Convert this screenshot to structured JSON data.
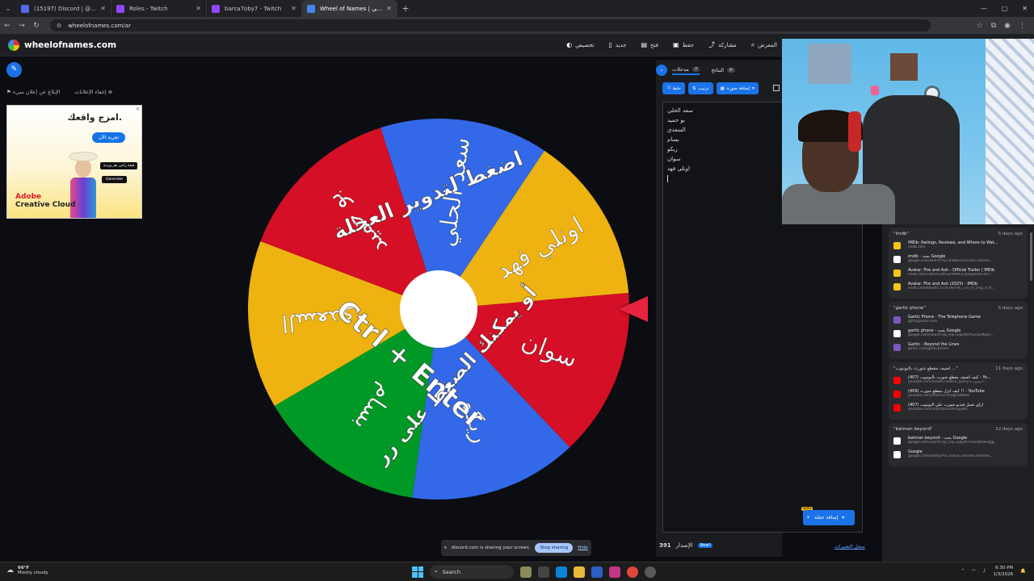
{
  "browser": {
    "tabs": [
      {
        "title": "(15197) Discord | @imvo",
        "color": "#5865f2",
        "active": false
      },
      {
        "title": "Roles - Twitch",
        "color": "#9146ff",
        "active": false
      },
      {
        "title": "barca7oby7 - Twitch",
        "color": "#9146ff",
        "active": false
      },
      {
        "title": "Wheel of Names | عجلة العشوائي",
        "color": "#4885ed",
        "active": true
      }
    ],
    "new_tab": "+",
    "url": "wheelofnames.com/ar"
  },
  "site": {
    "logo": "wheelofnames.com",
    "menu": [
      {
        "label": "المعرض",
        "icon": "⌕"
      },
      {
        "label": "مشاركة",
        "icon": "⤴"
      },
      {
        "label": "حفظ",
        "icon": "▣"
      },
      {
        "label": "فتح",
        "icon": "▤"
      },
      {
        "label": "جديد",
        "icon": "▯"
      },
      {
        "label": "تخصيص",
        "icon": "◐"
      }
    ]
  },
  "ad": {
    "hide_ads": "إخفاء الإعلانات",
    "report_ad": "الإبلاغ عن إعلان سيء",
    "headline": "امزج واقعك.",
    "cta": "تجربة الآن",
    "chip1": "قبعة راعي بقر وردية",
    "chip2": "Generate",
    "brand_line1": "Adobe",
    "brand_line2": "Creative Cloud"
  },
  "wheel": {
    "segments": [
      {
        "text": "سعد الحلي",
        "color": "#3369e8"
      },
      {
        "text": "اونلي فهد",
        "color": "#eeb211"
      },
      {
        "text": "سوان",
        "color": "#d50f25"
      },
      {
        "text": "ريكو",
        "color": "#3369e8"
      },
      {
        "text": "بسام",
        "color": "#009925"
      },
      {
        "text": "السعدي",
        "color": "#eeb211"
      },
      {
        "text": "بو حميد",
        "color": "#d50f25"
      }
    ],
    "overlay_line1": "اضغط لتدوير العجلة",
    "overlay_line2": "أو يمكنك الضغط على زر",
    "overlay_line3": "Ctrl + Enter"
  },
  "panel": {
    "tabs": [
      {
        "label": "مدخلات",
        "count": "7"
      },
      {
        "label": "النتائج",
        "count": "0"
      }
    ],
    "tools": [
      {
        "label": "خلط",
        "icon": "⤨"
      },
      {
        "label": "ترتيب",
        "icon": "⇅"
      },
      {
        "label": "إضافة صورة",
        "icon": "▦"
      }
    ],
    "entries": [
      "سعد الحلي",
      "بو حميد",
      "السعدي",
      "بسام",
      "ريكو",
      "سوان",
      "اونلي فهد"
    ],
    "add_image": "إضافة عجلة",
    "beta": "Beta",
    "version_label": "الإصدار",
    "version_number": "391",
    "new_badge": "New!",
    "changelog": "سجل التغييرات"
  },
  "history": [
    {
      "query": "\"imdb\"",
      "age": "5 days ago",
      "items": [
        {
          "title": "IMDb: Ratings, Reviews, and Where to Wat...",
          "url": "imdb.com",
          "color": "#f5c518"
        },
        {
          "title": "imdb - بحث Google",
          "url": "google.com/search?q=imdb&sourceid=chrome...",
          "color": "#ffffff"
        },
        {
          "title": "Avatar: Fire and Ash - Official Trailer | IMDb",
          "url": "imdb.com/video/vi2953299993/?playlistId=tt17...",
          "color": "#f5c518"
        },
        {
          "title": "Avatar: Fire and Ash (2025) - IMDb",
          "url": "imdb.com/title/tt1757678/?ref_=nv_sr_srsg_4_tt...",
          "color": "#f5c518"
        }
      ]
    },
    {
      "query": "\"gartic phone\"",
      "age": "5 days ago",
      "items": [
        {
          "title": "Gartic Phone - The Telephone Game",
          "url": "garticphone.com",
          "color": "#7e57c2"
        },
        {
          "title": "gartic phone - بحث Google",
          "url": "google.com/search?gs_ssp=eJzj4tVP1zc0LMgari...",
          "color": "#ffffff"
        },
        {
          "title": "Gartic - Beyond the Lines",
          "url": "gartic.com/garticphone",
          "color": "#7e57c2"
        }
      ]
    },
    {
      "query": "\"اضيف مقطع شورت باليوتيوب ...\"",
      "age": "11 days ago",
      "items": [
        {
          "title": "(407) كيف اضيف مقطع شورت باليوتيوب - Yo...",
          "url": "youtube.com/results?search_query=يوتيوب+...",
          "color": "#ff0000"
        },
        {
          "title": "(409) كيف انزل مقطع شورت !! - YouTube",
          "url": "youtube.com/shorts/F5FDgE9W8a8",
          "color": "#ff0000"
        },
        {
          "title": "(407) ازاي تعمل فيديو شورت علي اليوتيوب",
          "url": "youtube.com/shorts/t2GVN-Eg3K0",
          "color": "#ff0000"
        }
      ]
    },
    {
      "query": "\"batman beyond\"",
      "age": "12 days ago",
      "items": [
        {
          "title": "batman beyond - بحث Google",
          "url": "google.com/search?gs_ssp=eJzj4tTP1zc0KtwsdjgJ...",
          "color": "#ffffff"
        },
        {
          "title": "Google",
          "url": "google.com/webhp?hl=ar&sa=X&ved=0ahUKE...",
          "color": "#ffffff"
        }
      ]
    }
  ],
  "share_bar": {
    "message": "discord.com is sharing your screen.",
    "stop": "Stop sharing",
    "hide": "Hide"
  },
  "taskbar": {
    "temp": "66°F",
    "weather": "Mostly cloudy",
    "search": "Search",
    "time": "6:30 PM",
    "date": "1/3/2026"
  }
}
